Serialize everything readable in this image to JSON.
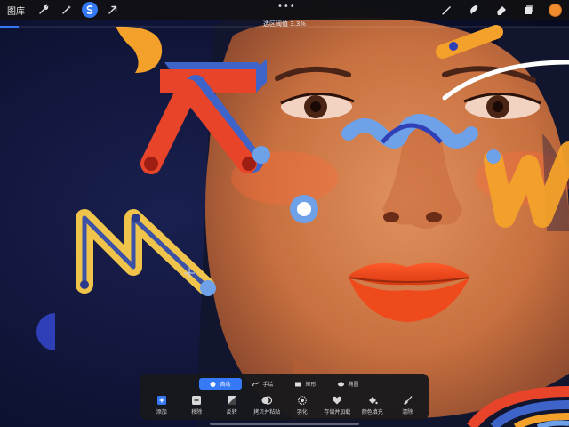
{
  "topbar": {
    "gallery_label": "图库",
    "left_tools": [
      {
        "name": "wrench-icon",
        "active": false
      },
      {
        "name": "magic-wand-icon",
        "active": false
      },
      {
        "name": "selection-icon",
        "active": true
      },
      {
        "name": "transform-arrow-icon",
        "active": false
      }
    ],
    "right_tools": [
      "brush-icon",
      "smudge-icon",
      "eraser-icon",
      "layers-icon"
    ],
    "current_color": "#f08c2e",
    "more_label": "•••"
  },
  "selection": {
    "threshold_text": "选区阈值 3.3%",
    "threshold_value_percent": 3.3
  },
  "panel": {
    "modes": [
      {
        "label": "自动",
        "icon": "dot-icon",
        "active": true
      },
      {
        "label": "手绘",
        "icon": "freehand-icon",
        "active": false
      },
      {
        "label": "矩形",
        "icon": "rectangle-icon",
        "active": false
      },
      {
        "label": "椭圆",
        "icon": "ellipse-icon",
        "active": false
      }
    ],
    "actions": [
      {
        "label": "添加",
        "icon": "add-icon"
      },
      {
        "label": "移除",
        "icon": "remove-icon"
      },
      {
        "label": "反转",
        "icon": "invert-icon"
      },
      {
        "label": "拷贝并粘贴",
        "icon": "copy-paste-icon"
      },
      {
        "label": "羽化",
        "icon": "feather-icon"
      },
      {
        "label": "存储并加载",
        "icon": "heart-icon"
      },
      {
        "label": "颜色填充",
        "icon": "fill-icon"
      },
      {
        "label": "清除",
        "icon": "clear-icon"
      }
    ]
  },
  "colors": {
    "accent": "#3579f6",
    "background": "#0b1230"
  }
}
